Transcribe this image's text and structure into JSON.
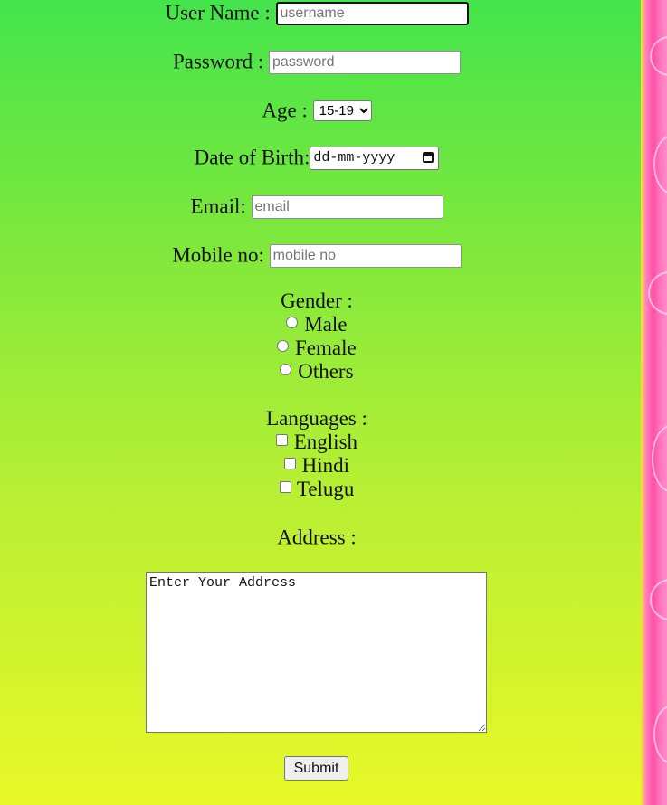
{
  "form": {
    "username": {
      "label": "User Name :",
      "placeholder": "username",
      "value": ""
    },
    "password": {
      "label": "Password :",
      "placeholder": "password",
      "value": ""
    },
    "age": {
      "label": "Age :",
      "selected": "15-19"
    },
    "dob": {
      "label": "Date of Birth:",
      "placeholder": "dd-mm-yyyy"
    },
    "email": {
      "label": "Email:",
      "placeholder": "email",
      "value": ""
    },
    "mobile": {
      "label": "Mobile no:",
      "placeholder": "mobile no",
      "value": ""
    },
    "gender": {
      "label": "Gender :",
      "options": [
        "Male",
        "Female",
        "Others"
      ]
    },
    "languages": {
      "label": "Languages :",
      "options": [
        "English",
        "Hindi",
        "Telugu"
      ]
    },
    "address": {
      "label": "Address :",
      "value": "Enter Your Address"
    },
    "submit_label": "Submit"
  },
  "colors": {
    "bg_top": "#44e44c",
    "bg_bottom": "#e8f827",
    "side_strip": "#ff4fa8"
  }
}
